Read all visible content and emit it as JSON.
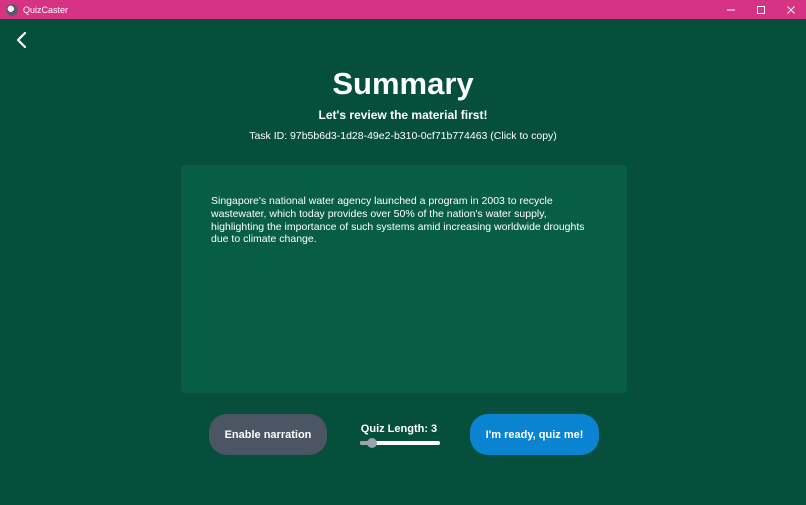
{
  "window": {
    "app_title": "QuizCaster",
    "titlebar_color": "#d63384"
  },
  "header": {
    "title": "Summary",
    "subtitle": "Let's review the material first!",
    "task_id": "Task ID: 97b5b6d3-1d28-49e2-b310-0cf71b774463 (Click to copy)"
  },
  "summary": {
    "text": "Singapore's national water agency launched a program in 2003 to recycle wastewater, which today provides over 50% of the nation's water supply, highlighting the importance of such systems amid increasing worldwide droughts due to climate change."
  },
  "controls": {
    "narration_label": "Enable narration",
    "quiz_length_label": "Quiz Length: 3",
    "quiz_length_value": 3,
    "quiz_length_fraction": 0.1,
    "ready_label": "I'm ready, quiz me!"
  },
  "colors": {
    "background": "#074f3d",
    "card": "#075e45",
    "narration_button": "#4b5563",
    "ready_button": "#0a84d0"
  },
  "icons": [
    "app-icon",
    "back-icon",
    "minimize-icon",
    "maximize-icon",
    "close-icon"
  ]
}
